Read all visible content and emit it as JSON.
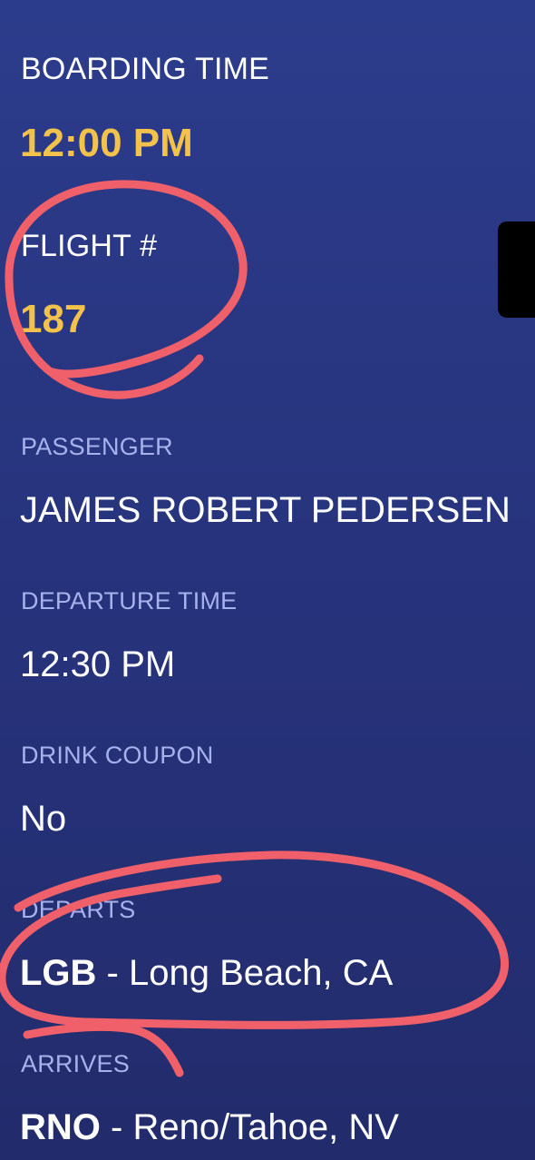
{
  "boarding_pass": {
    "boarding_time": {
      "label": "BOARDING TIME",
      "value": "12:00 PM"
    },
    "flight_number": {
      "label": "FLIGHT #",
      "value": "187"
    },
    "passenger": {
      "label": "PASSENGER",
      "value": "JAMES ROBERT PEDERSEN"
    },
    "departure_time": {
      "label": "DEPARTURE TIME",
      "value": "12:30 PM"
    },
    "drink_coupon": {
      "label": "DRINK COUPON",
      "value": "No"
    },
    "departs": {
      "label": "DEPARTS",
      "code": "LGB",
      "separator": " - ",
      "city": "Long Beach, CA"
    },
    "arrives": {
      "label": "ARRIVES",
      "code": "RNO",
      "separator": " - ",
      "city": "Reno/Tahoe, NV"
    }
  },
  "colors": {
    "background_top": "#2c3c8c",
    "background_bottom": "#222c6c",
    "accent_value": "#f3c24b",
    "muted_label": "#a7b2ec",
    "annotation_stroke": "#f0606a"
  }
}
